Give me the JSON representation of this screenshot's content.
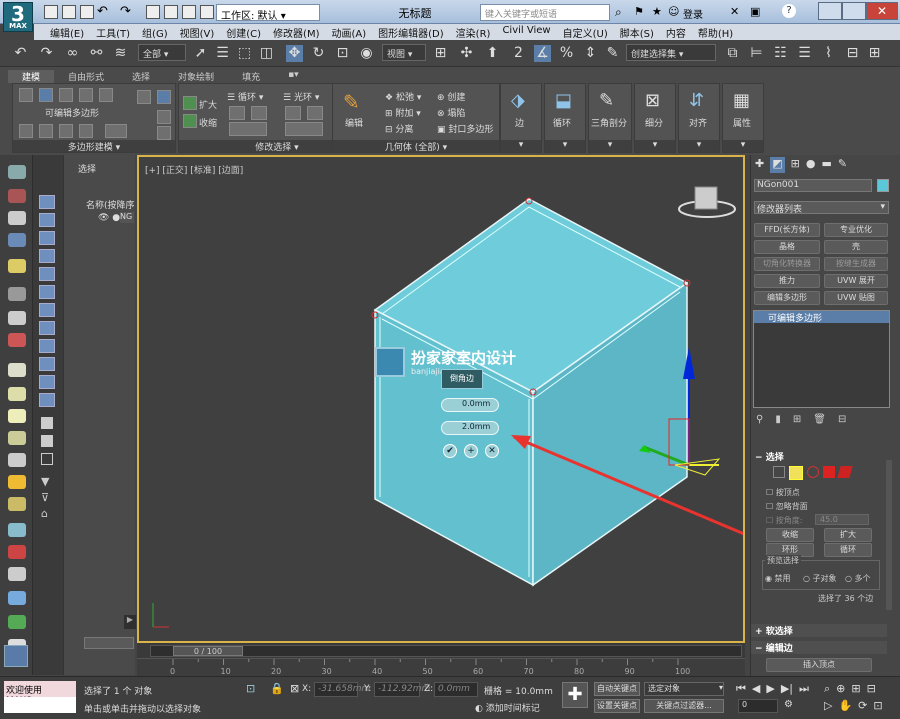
{
  "app": {
    "title": "无标题",
    "logo_text": "3",
    "logo_sub": "MAX",
    "workspace_label": "工作区: 默认",
    "search_placeholder": "键入关键字或短语",
    "login_label": "登录"
  },
  "menu": [
    "编辑(E)",
    "工具(T)",
    "组(G)",
    "视图(V)",
    "创建(C)",
    "修改器(M)",
    "动画(A)",
    "图形编辑器(D)",
    "渲染(R)",
    "Civil View",
    "自定义(U)",
    "脚本(S)",
    "内容",
    "帮助(H)"
  ],
  "toolbar": {
    "selection_filter": "全部",
    "reference_coord": "视图",
    "named_selection": "创建选择集"
  },
  "ribbon": {
    "tabs": [
      "建模",
      "自由形式",
      "选择",
      "对象绘制",
      "填充"
    ],
    "active_tab": "建模",
    "panel_polygon_modeling": {
      "title": "多边形建模",
      "label": "可编辑多边形"
    },
    "panel_modify_selection": {
      "title": "修改选择",
      "items": [
        "扩大",
        "收缩",
        "循环",
        "光环"
      ]
    },
    "panel_geometry": {
      "title": "几何体 (全部)",
      "edit_label": "编辑",
      "items": [
        "松弛",
        "创建",
        "附加",
        "塌陷",
        "分离",
        "封口多边形"
      ]
    },
    "panel_buttons": [
      "边",
      "循环",
      "三角剖分",
      "细分",
      "对齐",
      "属性"
    ]
  },
  "scene_explorer": {
    "select_label": "选择",
    "name_column": "名称(按降序",
    "node": "NG"
  },
  "viewport": {
    "label": "[+] [正交] [标准] [边面]",
    "watermark_title": "扮家家室内设计",
    "watermark_url": "banjiajia.com",
    "caddy_title": "倒角边",
    "caddy_value1": "0.0mm",
    "caddy_value2": "2.0mm",
    "time_display": "0 / 100",
    "ruler_ticks": [
      "0",
      "10",
      "20",
      "30",
      "40",
      "50",
      "60",
      "70",
      "80",
      "90",
      "100"
    ]
  },
  "command_panel": {
    "object_name": "NGon001",
    "modifier_list": "修改器列表",
    "modifier_buttons": [
      "FFD(长方体)",
      "专业优化",
      "晶格",
      "壳",
      "切角化转换器",
      "按缝生成器",
      "推力",
      "UVW 展开",
      "编辑多边形",
      "UVW 贴图"
    ],
    "stack_item": "可编辑多边形",
    "selection_header": "选择",
    "by_vertex": "按顶点",
    "ignore_backfacing": "忽略背面",
    "by_angle": "按角度:",
    "angle_value": "45.0",
    "shrink": "收缩",
    "grow": "扩大",
    "ring": "环形",
    "loop": "循环",
    "preview_selection": "预览选择",
    "preview_options": [
      "禁用",
      "子对象",
      "多个"
    ],
    "selected_status": "选择了 36 个边",
    "soft_selection": "软选择",
    "edit_edges": "编辑边",
    "insert_vertex": "插入顶点"
  },
  "status": {
    "welcome": "欢迎使用 MAXSc",
    "selected_info": "选择了 1 个 对象",
    "prompt": "单击或单击并拖动以选择对象",
    "x_label": "X:",
    "x_value": "-31.658mm",
    "y_label": "Y:",
    "y_value": "-112.92mm",
    "z_label": "Z:",
    "z_value": "0.0mm",
    "grid": "栅格 = 10.0mm",
    "add_time_tag": "添加时间标记",
    "auto_key": "自动关键点",
    "set_key": "设置关键点",
    "selected_object": "选定对象",
    "key_filters": "关键点过滤器...",
    "frame_value": "0"
  },
  "colors": {
    "accent_viewport_border": "#d8b44a",
    "box_fill": "#6dc8d6",
    "arrow_red": "#e8332f"
  }
}
